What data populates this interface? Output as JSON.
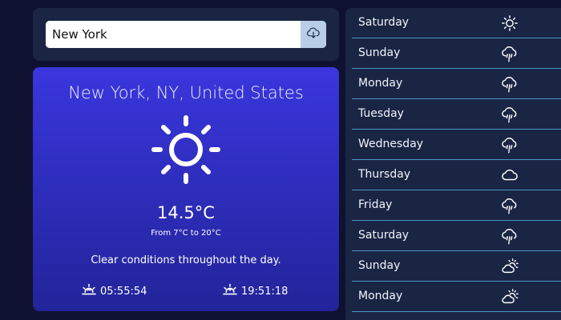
{
  "search": {
    "value": "New York",
    "button_icon": "cloud-download-icon"
  },
  "current": {
    "location": "New York, NY, United States",
    "icon": "sun-icon",
    "temperature": "14.5°C",
    "range": "From 7°C to 20°C",
    "summary": "Clear conditions throughout the day.",
    "sunrise": "05:55:54",
    "sunset": "19:51:18"
  },
  "forecast": [
    {
      "day": "Saturday",
      "icon": "sun-icon"
    },
    {
      "day": "Sunday",
      "icon": "rain-cloud-icon"
    },
    {
      "day": "Monday",
      "icon": "rain-cloud-icon"
    },
    {
      "day": "Tuesday",
      "icon": "rain-cloud-icon"
    },
    {
      "day": "Wednesday",
      "icon": "rain-cloud-icon"
    },
    {
      "day": "Thursday",
      "icon": "cloud-icon"
    },
    {
      "day": "Friday",
      "icon": "rain-cloud-icon"
    },
    {
      "day": "Saturday",
      "icon": "rain-cloud-icon"
    },
    {
      "day": "Sunday",
      "icon": "partly-cloudy-icon"
    },
    {
      "day": "Monday",
      "icon": "partly-cloudy-icon"
    }
  ],
  "colors": {
    "background": "#0f1130",
    "panel": "#1a2544",
    "card_gradient_top": "#3a36dd",
    "card_gradient_bottom": "#23249a",
    "divider": "#4a93c4",
    "search_button": "#b8cde6"
  }
}
